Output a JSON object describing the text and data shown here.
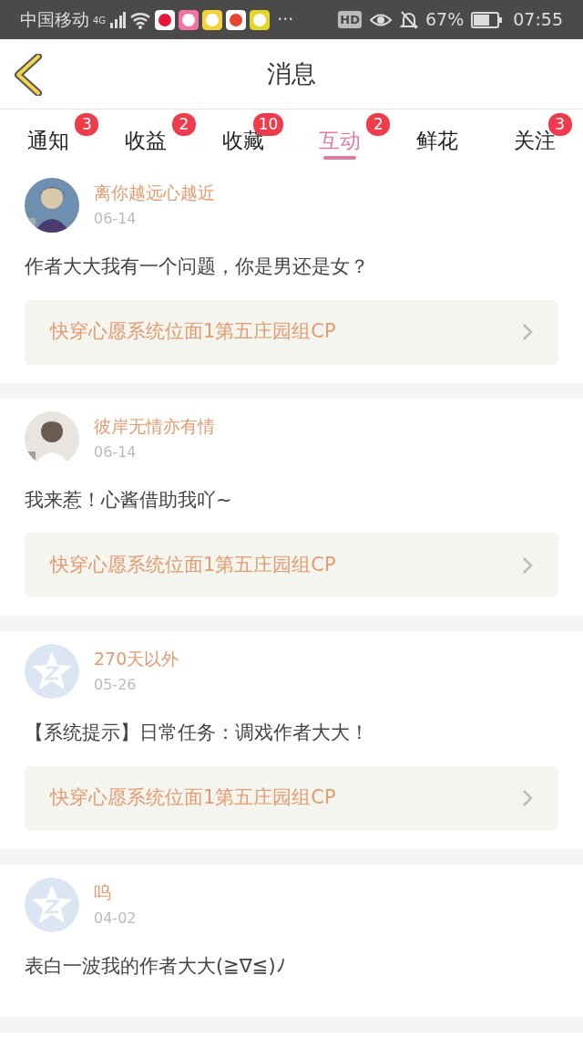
{
  "status_bar": {
    "carrier": "中国移动",
    "network": "4G",
    "more": "···",
    "hd": "HD",
    "battery_percent": "67%",
    "time": "07:55"
  },
  "header": {
    "title": "消息"
  },
  "tabs": [
    {
      "label": "通知",
      "badge": "3",
      "selected": false
    },
    {
      "label": "收益",
      "badge": "2",
      "selected": false
    },
    {
      "label": "收藏",
      "badge": "10",
      "selected": false
    },
    {
      "label": "互动",
      "badge": "2",
      "selected": true
    },
    {
      "label": "鲜花",
      "selected": false
    },
    {
      "label": "关注",
      "badge": "3",
      "selected": false
    }
  ],
  "messages": [
    {
      "user": "离你越远心越近",
      "date": "06-14",
      "text": "作者大大我有一个问题，你是男还是女？",
      "reference": "快穿心愿系统位面1第五庄园组CP"
    },
    {
      "user": "彼岸无情亦有情",
      "date": "06-14",
      "text": "我来惹！心酱借助我吖~",
      "reference": "快穿心愿系统位面1第五庄园组CP"
    },
    {
      "avatar": {
        "kind": "default"
      },
      "user": "270天以外",
      "date": "05-26",
      "text": "【系统提示】日常任务：调戏作者大大！",
      "reference": "快穿心愿系统位面1第五庄园组CP"
    },
    {
      "avatar": {
        "kind": "default"
      },
      "user": "呜",
      "date": "04-02",
      "text": "表白一波我的作者大大(≧∇≦)ﾉ"
    }
  ]
}
